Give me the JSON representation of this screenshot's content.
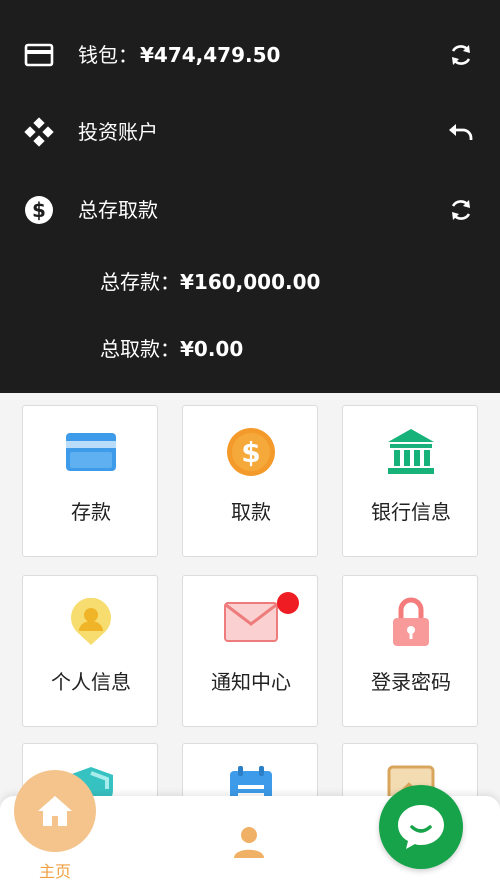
{
  "account": {
    "wallet_label": "钱包：",
    "wallet_amount": "¥474,479.50",
    "investment_label": "投资账户",
    "totals_label": "总存取款",
    "total_deposit_label": "总存款：",
    "total_deposit_amount": "¥160,000.00",
    "total_withdraw_label": "总取款：",
    "total_withdraw_amount": "¥0.00"
  },
  "menu": {
    "items": [
      {
        "label": "存款",
        "icon": "card-icon"
      },
      {
        "label": "取款",
        "icon": "dollar-coin-icon"
      },
      {
        "label": "银行信息",
        "icon": "bank-icon"
      },
      {
        "label": "个人信息",
        "icon": "user-profile-icon"
      },
      {
        "label": "通知中心",
        "icon": "mail-icon",
        "badge": true
      },
      {
        "label": "登录密码",
        "icon": "lock-icon"
      },
      {
        "label": "",
        "icon": "shield-icon"
      },
      {
        "label": "",
        "icon": "calendar-icon"
      },
      {
        "label": "",
        "icon": "edit-document-icon"
      }
    ]
  },
  "nav": {
    "home_label": "主页"
  },
  "colors": {
    "header_bg": "#1d1d1d",
    "home_accent": "#f5c48d",
    "chat_green": "#16a34a",
    "badge_red": "#ef1c24"
  }
}
